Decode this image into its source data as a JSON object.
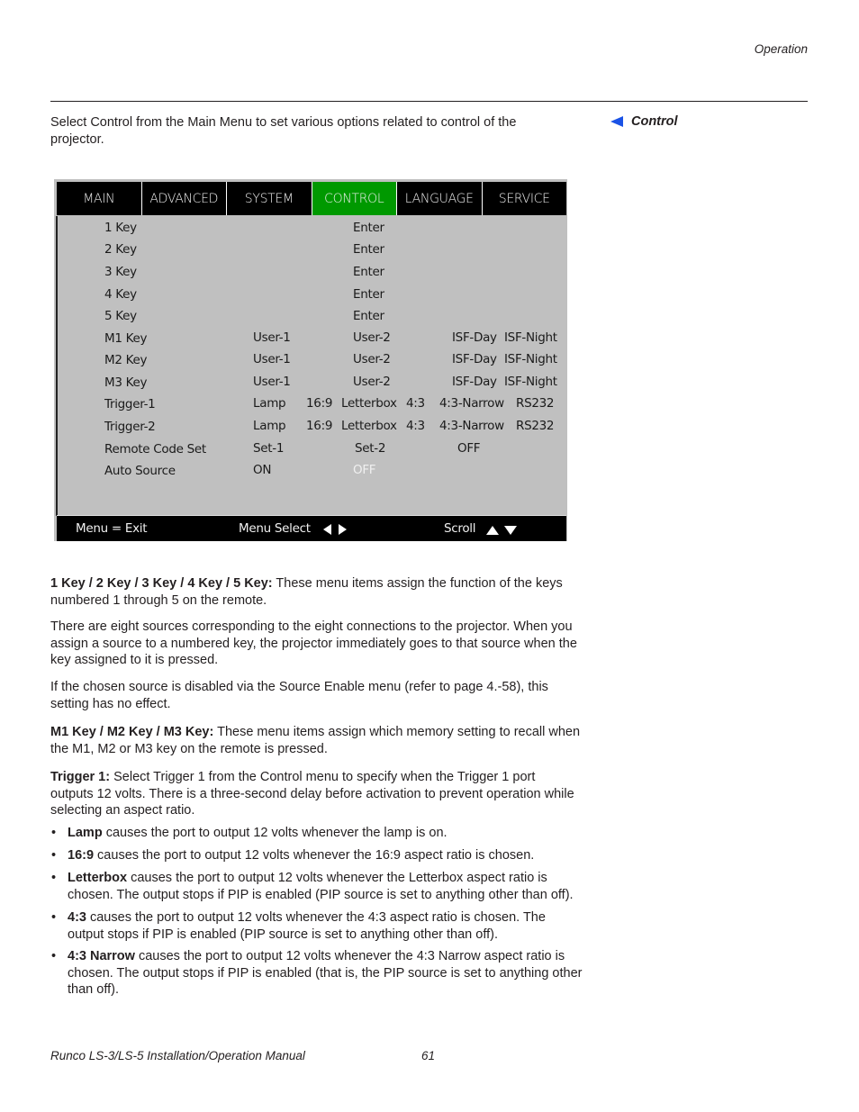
{
  "header": {
    "section": "Operation"
  },
  "intro": "Select Control from the Main Menu to set various options related to control of the projector.",
  "side_heading": {
    "icon": "arrow-left-icon",
    "label": "Control",
    "color": "#1a52e6"
  },
  "osd_menu": {
    "tabs": [
      {
        "label": "MAIN",
        "active": false
      },
      {
        "label": "ADVANCED",
        "active": false
      },
      {
        "label": "SYSTEM",
        "active": false
      },
      {
        "label": "CONTROL",
        "active": true
      },
      {
        "label": "LANGUAGE",
        "active": false
      },
      {
        "label": "SERVICE",
        "active": false
      }
    ],
    "active_tab_color": "#009900",
    "rows": [
      {
        "label": "1 Key",
        "values": [
          "Enter"
        ]
      },
      {
        "label": "2 Key",
        "values": [
          "Enter"
        ]
      },
      {
        "label": "3 Key",
        "values": [
          "Enter"
        ]
      },
      {
        "label": "4 Key",
        "values": [
          "Enter"
        ]
      },
      {
        "label": "5 Key",
        "values": [
          "Enter"
        ]
      },
      {
        "label": "M1 Key",
        "values": [
          "User-1",
          "User-2",
          "ISF-Day",
          "ISF-Night"
        ]
      },
      {
        "label": "M2 Key",
        "values": [
          "User-1",
          "User-2",
          "ISF-Day",
          "ISF-Night"
        ]
      },
      {
        "label": "M3 Key",
        "values": [
          "User-1",
          "User-2",
          "ISF-Day",
          "ISF-Night"
        ]
      },
      {
        "label": "Trigger-1",
        "values": [
          "Lamp",
          "16:9",
          "Letterbox",
          "4:3",
          "4:3-Narrow",
          "RS232"
        ]
      },
      {
        "label": "Trigger-2",
        "values": [
          "Lamp",
          "16:9",
          "Letterbox",
          "4:3",
          "4:3-Narrow",
          "RS232"
        ]
      },
      {
        "label": "Remote Code Set",
        "values": [
          "Set-1",
          "Set-2",
          "OFF"
        ]
      },
      {
        "label": "Auto Source",
        "values": [
          "ON",
          "OFF"
        ],
        "highlighted_value": "OFF"
      }
    ],
    "footer": {
      "exit": "Menu = Exit",
      "select": "Menu Select",
      "scroll": "Scroll"
    }
  },
  "sections": {
    "keys": {
      "term": "1 Key / 2 Key / 3 Key / 4 Key / 5 Key:",
      "text": " These menu items assign the function of the keys numbered 1 through 5 on the remote."
    },
    "sources": "There are eight sources corresponding to the eight connections to the projector. When you assign a source to a numbered key, the projector immediately goes to that source when the key assigned to it is pressed.",
    "disabled": "If the chosen source is disabled via the Source Enable menu (refer to page 4.-58), this setting has no effect.",
    "mkeys": {
      "term": "M1 Key / M2 Key / M3 Key:",
      "text": " These menu items assign which memory setting to recall when the M1, M2 or M3 key on the remote is pressed."
    },
    "trigger": {
      "term": "Trigger 1:",
      "text": " Select Trigger 1 from the Control menu to specify when the Trigger 1 port outputs 12 volts. There is a three-second delay before activation to prevent operation while selecting an aspect ratio."
    },
    "bullets": [
      {
        "term": "Lamp",
        "text": " causes the port to output 12 volts whenever the lamp is on."
      },
      {
        "term": "16:9",
        "text": " causes the port to output 12 volts whenever the 16:9 aspect ratio is chosen."
      },
      {
        "term": "Letterbox",
        "text": " causes the port to output 12 volts whenever the Letterbox aspect ratio is chosen. The output stops if PIP is enabled (PIP source is set to anything other than off)."
      },
      {
        "term": "4:3",
        "text": " causes the port to output 12 volts whenever the 4:3 aspect ratio is chosen. The output stops if PIP is enabled (PIP source is set to anything other than off)."
      },
      {
        "term": "4:3 Narrow",
        "text": " causes the port to output 12 volts whenever the 4:3 Narrow aspect ratio is chosen.  The output stops if PIP is enabled (that is, the PIP source is set to anything other than off)."
      }
    ]
  },
  "footer": {
    "title": "Runco LS-3/LS-5 Installation/Operation Manual",
    "page": "61"
  }
}
